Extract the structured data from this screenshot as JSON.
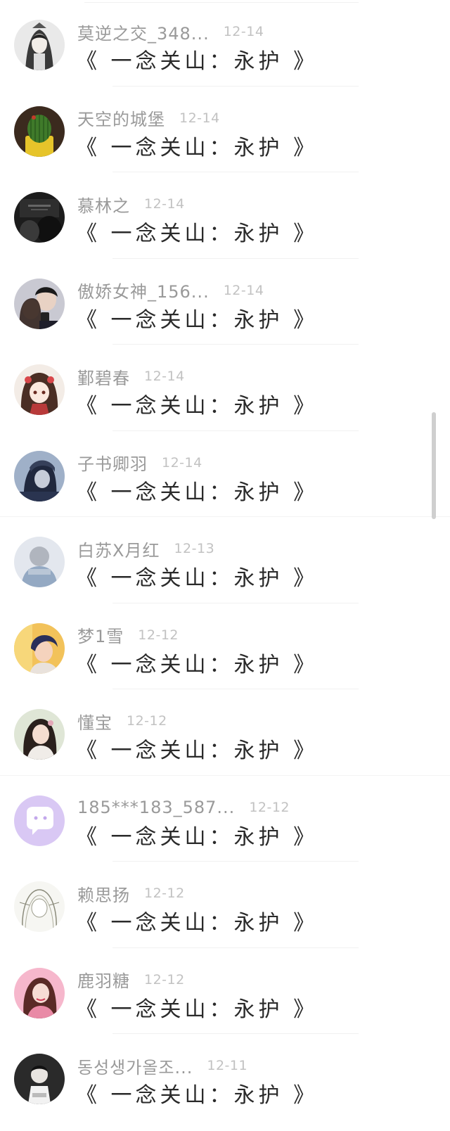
{
  "comments": [
    {
      "name": "莫逆之交_348...",
      "date": "12-14",
      "text": "《 一念关山：永护 》",
      "avatar": "ink-portrait-girl-avatar"
    },
    {
      "name": "天空的城堡",
      "date": "12-14",
      "text": "《 一念关山：永护 》",
      "avatar": "cactus-avatar"
    },
    {
      "name": "慕林之",
      "date": "12-14",
      "text": "《 一念关山：永护 》",
      "avatar": "dark-couple-avatar"
    },
    {
      "name": "傲娇女神_156...",
      "date": "12-14",
      "text": "《 一念关山：永护 》",
      "avatar": "couple-selfie-avatar"
    },
    {
      "name": "鄞碧春",
      "date": "12-14",
      "text": "《 一念关山：永护 》",
      "avatar": "anime-girl-avatar"
    },
    {
      "name": "子书卿羽",
      "date": "12-14",
      "text": "《 一念关山：永护 》",
      "avatar": "hooded-figure-avatar"
    },
    {
      "name": "白苏X月红",
      "date": "12-13",
      "text": "《 一念关山：永护 》",
      "avatar": "blurred-person-avatar"
    },
    {
      "name": "梦1雪",
      "date": "12-12",
      "text": "《 一念关山：永护 》",
      "avatar": "anime-boy-avatar"
    },
    {
      "name": "懂宝",
      "date": "12-12",
      "text": "《 一念关山：永护 》",
      "avatar": "woman-portrait-avatar"
    },
    {
      "name": "185***183_587...",
      "date": "12-12",
      "text": "《 一念关山：永护 》",
      "avatar": "chat-bubble-default-avatar"
    },
    {
      "name": "赖思扬",
      "date": "12-12",
      "text": "《 一念关山：永护 》",
      "avatar": "sketch-elf-avatar"
    },
    {
      "name": "鹿羽糖",
      "date": "12-12",
      "text": "《 一念关山：永护 》",
      "avatar": "pink-girl-avatar"
    },
    {
      "name": "동성생가올조...",
      "date": "12-11",
      "text": "《 一念关山：永护 》",
      "avatar": "cartoon-boy-avatar"
    }
  ],
  "colors": {
    "name": "#9a9a9a",
    "date": "#c2c2c2",
    "content": "#2a2a2a",
    "default_avatar": "#d9c8f4"
  }
}
